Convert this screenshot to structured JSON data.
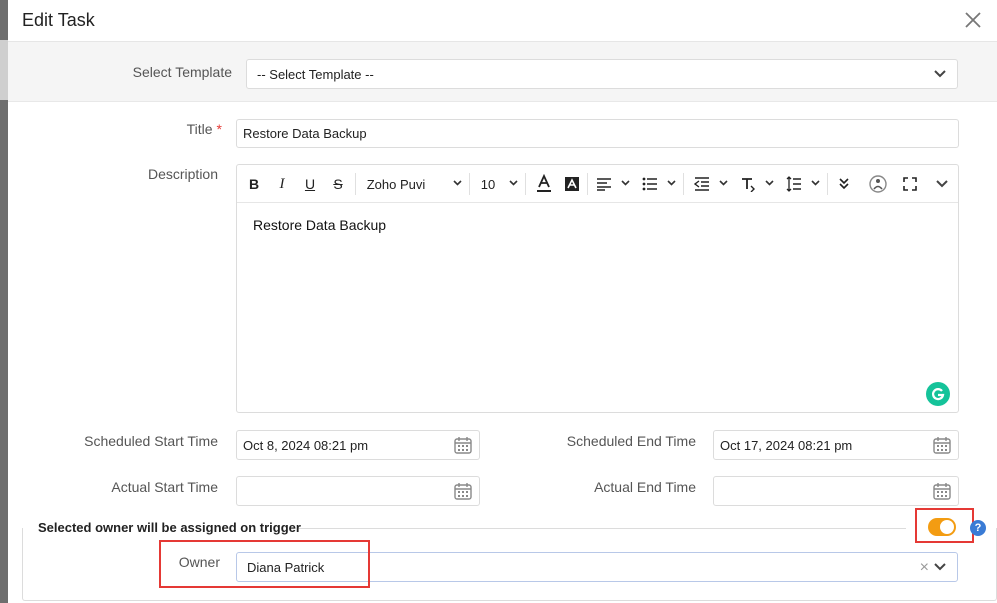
{
  "dialog": {
    "title": "Edit Task",
    "close_icon": "close-icon"
  },
  "template": {
    "label": "Select Template",
    "value": "-- Select Template --"
  },
  "title_field": {
    "label": "Title",
    "required_mark": "*",
    "value": "Restore Data Backup"
  },
  "description": {
    "label": "Description",
    "toolbar": {
      "bold": "B",
      "italic": "I",
      "underline": "U",
      "strike": "S",
      "font": "Zoho Puvi",
      "size": "10"
    },
    "content": "Restore Data Backup"
  },
  "schedule": {
    "start_label": "Scheduled Start Time",
    "start_value": "Oct 8, 2024 08:21 pm",
    "end_label": "Scheduled End Time",
    "end_value": "Oct 17, 2024 08:21 pm"
  },
  "actual": {
    "start_label": "Actual Start Time",
    "start_value": "",
    "end_label": "Actual End Time",
    "end_value": ""
  },
  "owner_section": {
    "title": "Selected owner will be assigned on trigger",
    "toggle_on": true,
    "help": "?",
    "owner_label": "Owner",
    "owner_value": "Diana Patrick",
    "clear_icon": "×"
  },
  "colors": {
    "accent": "#f39c12",
    "required": "#e53935",
    "highlight": "#e53935",
    "help": "#3a7bd5"
  }
}
